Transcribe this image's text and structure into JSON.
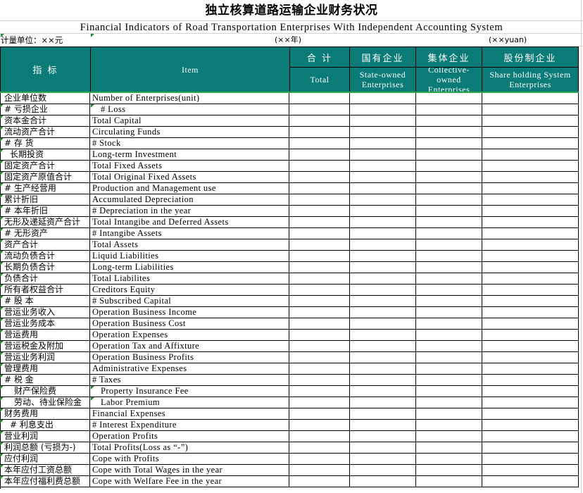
{
  "document": {
    "title_zh": "独立核算道路运输企业财务状况",
    "title_en": "Financial Indicators of Road Transportation Enterprises With Independent Accounting System",
    "unit_label_zh": "计量单位：××元",
    "period_zh": "(××年)",
    "unit_label_en": "(××yuan)"
  },
  "colors": {
    "header_background": "#0b7b77",
    "header_text": "#ffffff",
    "accent_line": "#2aa84a",
    "grid_line": "#000000",
    "comment_marker": "#1f8b3a"
  },
  "table": {
    "header": {
      "indicator_zh": "指    标",
      "indicator_en": "Item",
      "columns": [
        {
          "zh": "合  计",
          "en": "Total"
        },
        {
          "zh": "国有企业",
          "en": "State-owned\nEnterprises"
        },
        {
          "zh": "集体企业",
          "en": "Collective-\nowned\nEnterprises"
        },
        {
          "zh": "股份制企业",
          "en": "Share holding System\nEnterprises"
        }
      ]
    },
    "rows": [
      {
        "zh": "企业单位数",
        "en": "Number of Enterprises(unit)",
        "zh_style": "normal",
        "en_style": "normal",
        "marker": false
      },
      {
        "zh": "# 亏损企业",
        "en": "#  Loss",
        "zh_style": "normal",
        "en_style": "indent",
        "marker": true
      },
      {
        "zh": "资本金合计",
        "en": "Total Capital",
        "zh_style": "normal",
        "en_style": "normal",
        "marker": true
      },
      {
        "zh": "流动资产合计",
        "en": "Circulating Funds",
        "zh_style": "normal",
        "en_style": "normal",
        "marker": true
      },
      {
        "zh": "# 存    货",
        "en": "#  Stock",
        "zh_style": "normal",
        "en_style": "normal",
        "marker": true
      },
      {
        "zh": "长期投资",
        "en": "Long-term Investment",
        "zh_style": "indent2",
        "en_style": "normal",
        "marker": true
      },
      {
        "zh": "固定资产合计",
        "en": "Total Fixed Assets",
        "zh_style": "normal",
        "en_style": "normal",
        "marker": true
      },
      {
        "zh": "固定资产原值合计",
        "en": "Total Original Fixed Assets",
        "zh_style": "normal",
        "en_style": "normal",
        "marker": true
      },
      {
        "zh": "# 生产经营用",
        "en": "Production and Management use",
        "zh_style": "normal",
        "en_style": "normal",
        "marker": true
      },
      {
        "zh": "累计折旧",
        "en": "Accumulated Depreciation",
        "zh_style": "normal",
        "en_style": "normal",
        "marker": true
      },
      {
        "zh": "# 本年折旧",
        "en": "#  Depreciation in the year",
        "zh_style": "normal",
        "en_style": "normal",
        "marker": true
      },
      {
        "zh": "无形及递延资产合计",
        "en": "Total Intangibe and Deferred Assets",
        "zh_style": "normal",
        "en_style": "normal",
        "marker": true
      },
      {
        "zh": "# 无形资产",
        "en": "#  Intangibe Assets",
        "zh_style": "normal",
        "en_style": "normal",
        "marker": true
      },
      {
        "zh": "资产合计",
        "en": "Total Assets",
        "zh_style": "normal",
        "en_style": "normal",
        "marker": true
      },
      {
        "zh": "流动负债合计",
        "en": "Liquid Liabilities",
        "zh_style": "normal",
        "en_style": "normal",
        "marker": true
      },
      {
        "zh": "长期负债合计",
        "en": "Long-term Liabilities",
        "zh_style": "normal",
        "en_style": "normal",
        "marker": true
      },
      {
        "zh": "负债合计",
        "en": "Total Liabilites",
        "zh_style": "normal",
        "en_style": "normal",
        "marker": true
      },
      {
        "zh": "所有者权益合计",
        "en": "Creditors Equity",
        "zh_style": "normal",
        "en_style": "normal",
        "marker": true
      },
      {
        "zh": "# 股    本",
        "en": "#    Subscribed Capital",
        "zh_style": "normal",
        "en_style": "normal",
        "marker": true
      },
      {
        "zh": "营运业务收入",
        "en": "Operation Business Income",
        "zh_style": "normal",
        "en_style": "normal",
        "marker": true
      },
      {
        "zh": "营运业务成本",
        "en": "Operation Business Cost",
        "zh_style": "normal",
        "en_style": "normal",
        "marker": true
      },
      {
        "zh": "营运费用",
        "en": "Operation Expenses",
        "zh_style": "normal",
        "en_style": "normal",
        "marker": true
      },
      {
        "zh": "营运税金及附加",
        "en": "Operation Tax and Affixture",
        "zh_style": "normal",
        "en_style": "normal",
        "marker": true
      },
      {
        "zh": "营运业务利润",
        "en": "Operation Business Profits",
        "zh_style": "normal",
        "en_style": "normal",
        "marker": true
      },
      {
        "zh": "管理费用",
        "en": "Administrative Expenses",
        "zh_style": "normal",
        "en_style": "normal",
        "marker": true
      },
      {
        "zh": "# 税    金",
        "en": "# Taxes",
        "zh_style": "normal",
        "en_style": "normal",
        "marker": true
      },
      {
        "zh": "财产保险费",
        "en": "Property Insurance Fee",
        "zh_style": "indent",
        "en_style": "indent",
        "marker": true
      },
      {
        "zh": "劳动、待业保险金",
        "en": "Labor Premium",
        "zh_style": "indent",
        "en_style": "indent",
        "marker": true
      },
      {
        "zh": "财务费用",
        "en": "Financial Expenses",
        "zh_style": "normal",
        "en_style": "normal",
        "marker": true
      },
      {
        "zh": "# 利息支出",
        "en": "#  Interest Expenditure",
        "zh_style": "indent2",
        "en_style": "normal",
        "marker": true
      },
      {
        "zh": "营业利润",
        "en": "Operation Profits",
        "zh_style": "normal",
        "en_style": "normal",
        "marker": true
      },
      {
        "zh": "利润总额 (亏损为-)",
        "en": "Total Profits(Loss as “-”)",
        "zh_style": "normal",
        "en_style": "normal",
        "marker": true
      },
      {
        "zh": "应付利润",
        "en": "Cope with Profits",
        "zh_style": "normal",
        "en_style": "normal",
        "marker": true
      },
      {
        "zh": "本年应付工资总额",
        "en": "Cope with Total Wages in the year",
        "zh_style": "normal",
        "en_style": "normal",
        "marker": true
      },
      {
        "zh": "本年应付福利费总额",
        "en": "Cope with Welfare Fee in the year",
        "zh_style": "normal",
        "en_style": "normal",
        "marker": true
      }
    ],
    "value_columns_empty": true
  }
}
